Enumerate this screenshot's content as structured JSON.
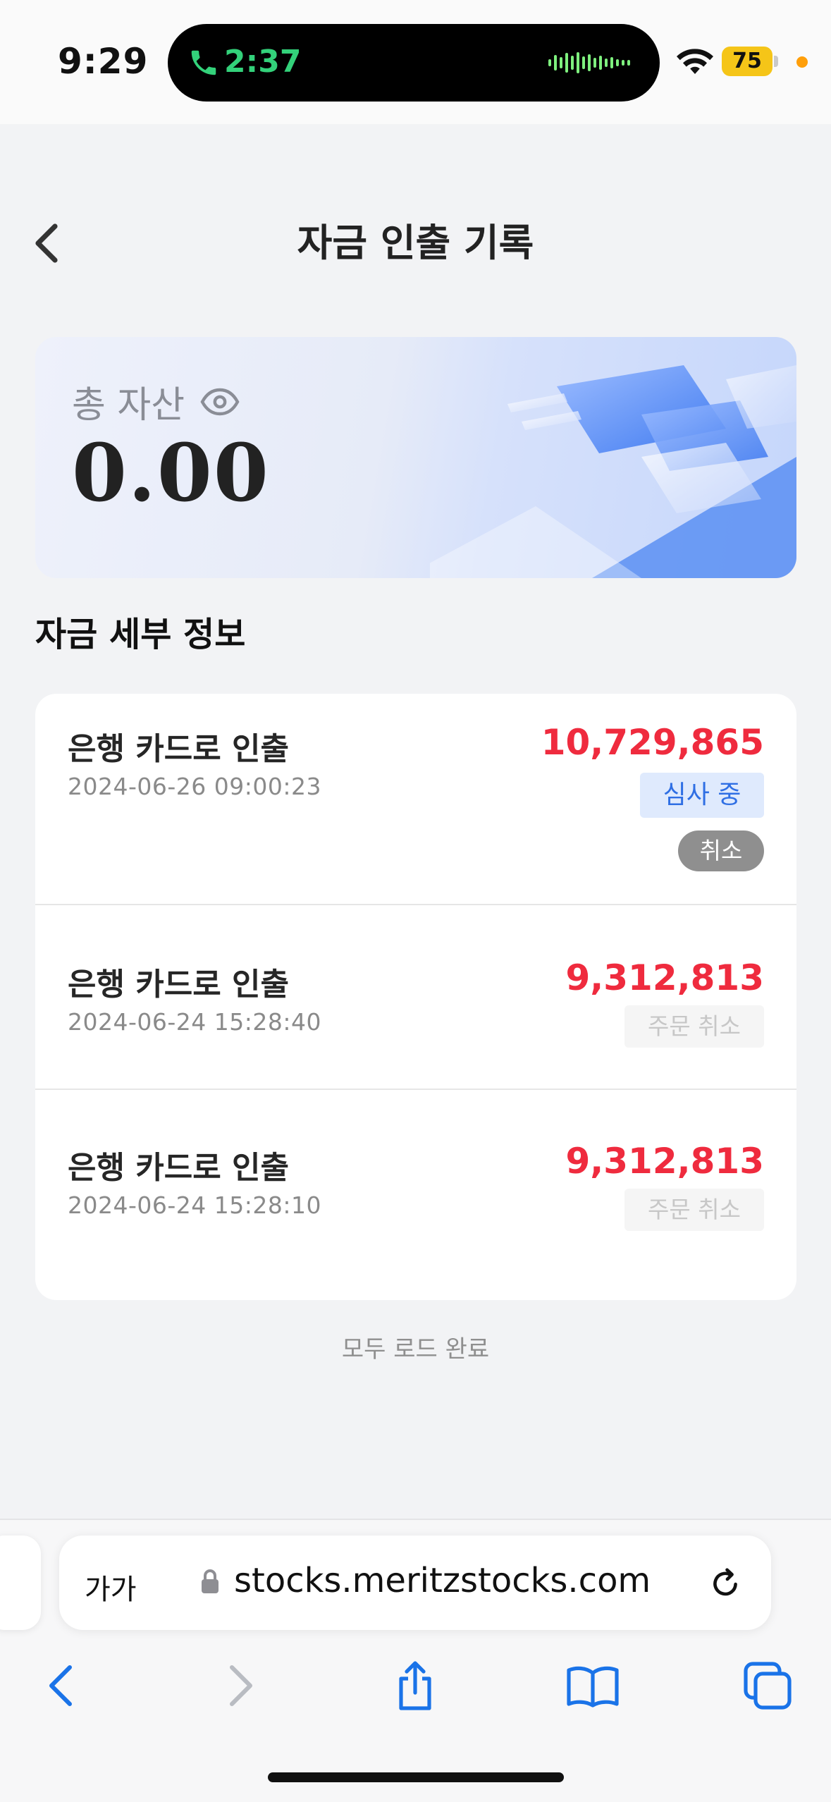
{
  "status_bar": {
    "time": "9:29",
    "call_time": "2:37",
    "battery": "75",
    "icons": [
      "call-icon",
      "waveform-icon",
      "wifi-icon",
      "battery-icon",
      "privacy-dot"
    ]
  },
  "header": {
    "title": "자금 인출 기록",
    "back_icon": "chevron-left-icon"
  },
  "asset_card": {
    "label": "총 자산",
    "value": "0.00",
    "eye_icon": "eye-icon"
  },
  "section_title": "자금 세부 정보",
  "records": [
    {
      "title": "은행 카드로 인출",
      "date": "2024-06-26 09:00:23",
      "amount": "10,729,865",
      "status": "심사 중",
      "action": "취소"
    },
    {
      "title": "은행 카드로 인출",
      "date": "2024-06-24 15:28:40",
      "amount": "9,312,813",
      "status": "주문 취소"
    },
    {
      "title": "은행 카드로 인출",
      "date": "2024-06-24 15:28:10",
      "amount": "9,312,813",
      "status": "주문 취소"
    }
  ],
  "load_complete": "모두 로드 완료",
  "browser": {
    "aa_label": "가가",
    "url": "stocks.meritzstocks.com",
    "toolbar": [
      "back-icon",
      "forward-icon",
      "share-icon",
      "bookmarks-icon",
      "tabs-icon"
    ]
  },
  "colors": {
    "amount": "#ef2b3e",
    "review_badge_bg": "#dfeafd",
    "review_badge_text": "#2f6fe4",
    "safari_blue": "#1a73e8",
    "call_green": "#33d17a",
    "battery_yellow": "#f5c518"
  }
}
